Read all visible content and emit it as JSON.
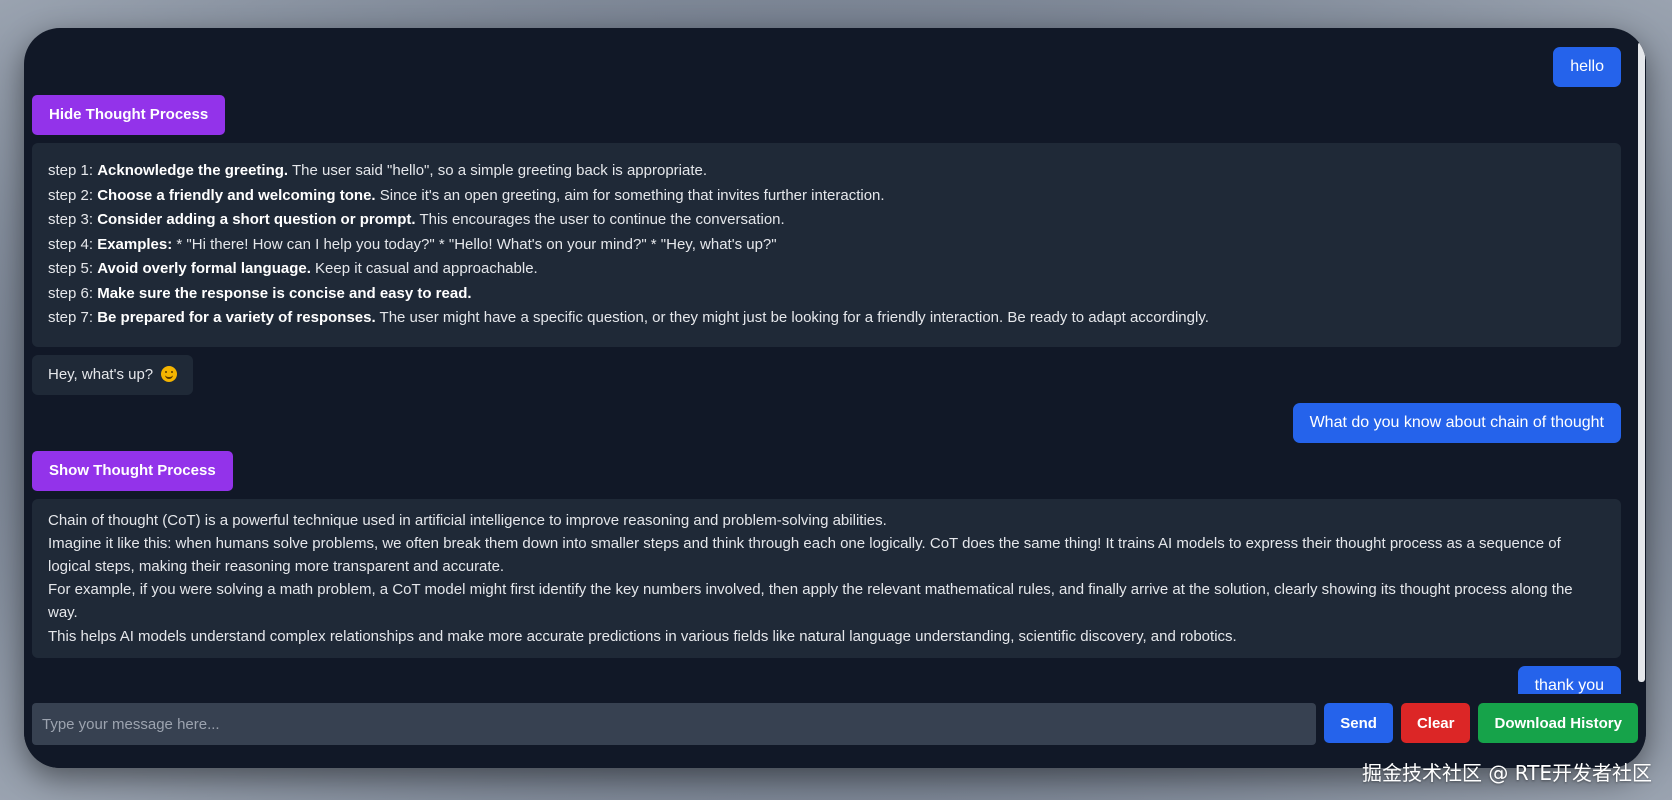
{
  "messages": {
    "user1": "hello",
    "toggle1": "Hide Thought Process",
    "thought_steps": [
      {
        "prefix": "step 1:",
        "bold": "Acknowledge the greeting.",
        "rest": " The user said \"hello\", so a simple greeting back is appropriate."
      },
      {
        "prefix": "step 2:",
        "bold": "Choose a friendly and welcoming tone.",
        "rest": " Since it's an open greeting, aim for something that invites further interaction."
      },
      {
        "prefix": "step 3:",
        "bold": "Consider adding a short question or prompt.",
        "rest": " This encourages the user to continue the conversation."
      },
      {
        "prefix": "step 4:",
        "bold": "Examples:",
        "rest": " * \"Hi there! How can I help you today?\" * \"Hello! What's on your mind?\" * \"Hey, what's up?\""
      },
      {
        "prefix": "step 5:",
        "bold": "Avoid overly formal language.",
        "rest": " Keep it casual and approachable."
      },
      {
        "prefix": "step 6:",
        "bold": "Make sure the response is concise and easy to read.",
        "rest": ""
      },
      {
        "prefix": "step 7:",
        "bold": "Be prepared for a variety of responses.",
        "rest": " The user might have a specific question, or they might just be looking for a friendly interaction. Be ready to adapt accordingly."
      }
    ],
    "bot1": "Hey, what's up?",
    "user2": "What do you know about chain of thought",
    "toggle2": "Show Thought Process",
    "bot2_lines": [
      "Chain of thought (CoT) is a powerful technique used in artificial intelligence to improve reasoning and problem-solving abilities.",
      "Imagine it like this: when humans solve problems, we often break them down into smaller steps and think through each one logically. CoT does the same thing! It trains AI models to express their thought process as a sequence of logical steps, making their reasoning more transparent and accurate.",
      "For example, if you were solving a math problem, a CoT model might first identify the key numbers involved, then apply the relevant mathematical rules, and finally arrive at the solution, clearly showing its thought process along the way.",
      "This helps AI models understand complex relationships and make more accurate predictions in various fields like natural language understanding, scientific discovery, and robotics."
    ],
    "user3": "thank you"
  },
  "input": {
    "placeholder": "Type your message here..."
  },
  "buttons": {
    "send": "Send",
    "clear": "Clear",
    "download": "Download History"
  },
  "watermark": "掘金技术社区 @ RTE开发者社区",
  "icons": {
    "smile": "smiling-face-emoji"
  },
  "colors": {
    "user_bubble": "#2563eb",
    "toggle": "#9333ea",
    "clear": "#dc2626",
    "download": "#16a34a",
    "background": "#111827",
    "panel": "#1f2937"
  }
}
